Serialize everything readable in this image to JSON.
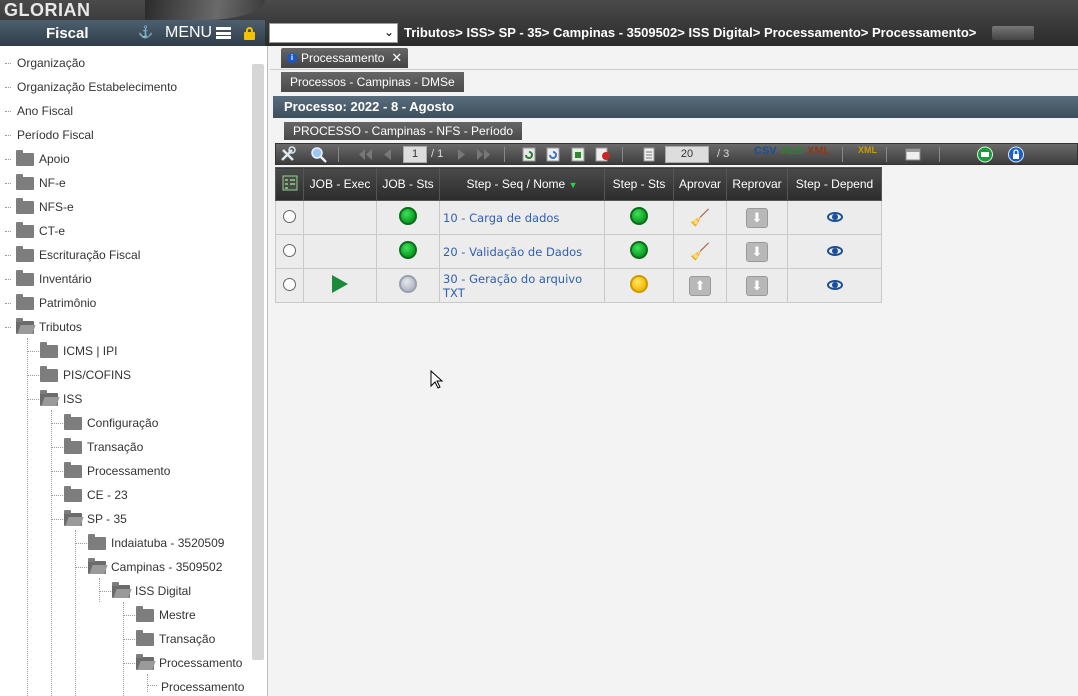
{
  "app": {
    "logo": "GLORIAN",
    "module_title": "Fiscal",
    "menu_label": "MENU"
  },
  "header": {
    "company_select_value": "",
    "breadcrumb": "Tributos> ISS> SP - 35> Campinas - 3509502> ISS Digital> Processamento> Processamento>"
  },
  "sidebar": {
    "items": [
      {
        "label": "Organização",
        "type": "leaf"
      },
      {
        "label": "Organização Estabelecimento",
        "type": "leaf"
      },
      {
        "label": "Ano Fiscal",
        "type": "leaf"
      },
      {
        "label": "Período Fiscal",
        "type": "leaf"
      },
      {
        "label": "Apoio",
        "type": "folder"
      },
      {
        "label": "NF-e",
        "type": "folder"
      },
      {
        "label": "NFS-e",
        "type": "folder"
      },
      {
        "label": "CT-e",
        "type": "folder"
      },
      {
        "label": "Escrituração Fiscal",
        "type": "folder"
      },
      {
        "label": "Inventário",
        "type": "folder"
      },
      {
        "label": "Patrimônio",
        "type": "folder"
      },
      {
        "label": "Tributos",
        "type": "folder-open"
      },
      {
        "label": "ICMS | IPI",
        "type": "folder"
      },
      {
        "label": "PIS/COFINS",
        "type": "folder"
      },
      {
        "label": "ISS",
        "type": "folder-open"
      },
      {
        "label": "Configuração",
        "type": "folder"
      },
      {
        "label": "Transação",
        "type": "folder"
      },
      {
        "label": "Processamento",
        "type": "folder"
      },
      {
        "label": "CE - 23",
        "type": "folder"
      },
      {
        "label": "SP - 35",
        "type": "folder-open"
      },
      {
        "label": "Indaiatuba - 3520509",
        "type": "folder"
      },
      {
        "label": "Campinas - 3509502",
        "type": "folder-open"
      },
      {
        "label": "ISS Digital",
        "type": "folder-open"
      },
      {
        "label": "Mestre",
        "type": "folder"
      },
      {
        "label": "Transação",
        "type": "folder"
      },
      {
        "label": "Processamento",
        "type": "folder-open"
      },
      {
        "label": "Processamento",
        "type": "leaf"
      }
    ]
  },
  "main": {
    "tab_label": "Processamento",
    "subtitle": "Processos - Campinas - DMSe",
    "process_header": "Processo: 2022 - 8 - Agosto",
    "process_subheader": "PROCESSO - Campinas - NFS - Período",
    "toolbar": {
      "page_current": "1",
      "page_total": "/ 1",
      "rows_per_page": "20",
      "rows_total": "/ 3",
      "export_csv": "CSV",
      "export_xls": "XLS",
      "export_xml": "XML",
      "xml_icon_label": "XML"
    },
    "grid": {
      "columns": [
        "JOB - Exec",
        "JOB - Sts",
        "Step - Seq / Nome",
        "Step - Sts",
        "Aprovar",
        "Reprovar",
        "Step - Depend"
      ],
      "rows": [
        {
          "job_exec": "",
          "job_sts": "green",
          "step": "10 - Carga de dados",
          "step_sts": "green",
          "aprovar": "broom",
          "reprovar": "thumb"
        },
        {
          "job_exec": "",
          "job_sts": "green",
          "step": "20 - Validação de Dados",
          "step_sts": "green",
          "aprovar": "broom",
          "reprovar": "thumb"
        },
        {
          "job_exec": "play",
          "job_sts": "grey",
          "step": "30 - Geração do arquivo TXT",
          "step_sts": "yellow",
          "aprovar": "thumb",
          "reprovar": "thumb"
        }
      ]
    }
  },
  "colors": {
    "header_dark": "#2b2b2b",
    "fiscal_bar": "#3a4a57",
    "link_blue": "#2f5fb0",
    "status_green": "#12b22e",
    "status_yellow": "#f3bb00",
    "play_green": "#1c8a3b"
  }
}
